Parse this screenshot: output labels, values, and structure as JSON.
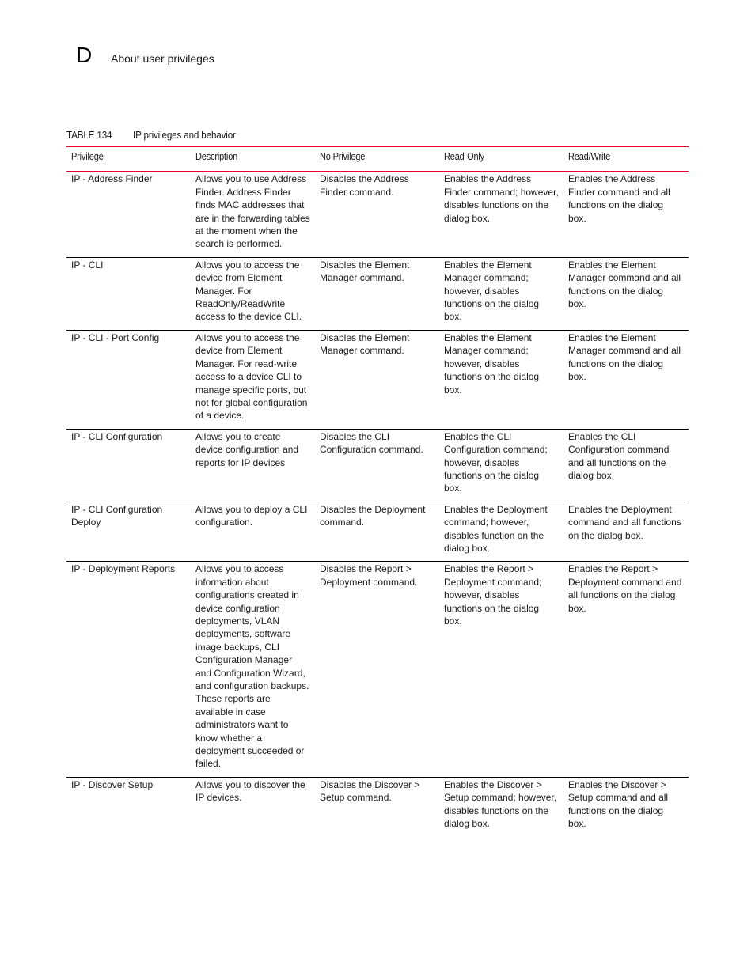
{
  "header": {
    "chapter_letter": "D",
    "section_title": "About user privileges"
  },
  "table": {
    "caption_number": "TABLE 134",
    "caption_title": "IP privileges and behavior",
    "columns": [
      "Privilege",
      "Description",
      "No Privilege",
      "Read-Only",
      "Read/Write"
    ],
    "rows": [
      {
        "privilege": "IP - Address Finder",
        "description": "Allows you to use Address Finder. Address Finder finds MAC addresses that are in the forwarding tables at the moment when the search is performed.",
        "no_privilege": "Disables the Address Finder command.",
        "read_only": "Enables the Address Finder command; however, disables functions on the dialog box.",
        "read_write": "Enables the Address Finder command and all functions on the dialog box."
      },
      {
        "privilege": "IP - CLI",
        "description": "Allows you to access the device from Element Manager. For ReadOnly/ReadWrite access to the device CLI.",
        "no_privilege": "Disables the Element Manager command.",
        "read_only": "Enables the Element Manager command; however, disables functions on the dialog box.",
        "read_write": "Enables the Element Manager command and all functions on the dialog box."
      },
      {
        "privilege": "IP - CLI - Port Config",
        "description": "Allows you to access the device from Element Manager. For read-write access to a device CLI to manage specific ports, but not for global configuration of a device.",
        "no_privilege": "Disables the Element Manager command.",
        "read_only": "Enables the Element Manager command; however, disables functions on the dialog box.",
        "read_write": "Enables the Element Manager command and all functions on the dialog box."
      },
      {
        "privilege": "IP - CLI Configuration",
        "description": "Allows you to create device configuration and reports for IP devices",
        "no_privilege": "Disables the CLI Configuration command.",
        "read_only": "Enables the CLI Configuration command; however, disables functions on the dialog box.",
        "read_write": "Enables the CLI Configuration command and all functions on the dialog box."
      },
      {
        "privilege": "IP - CLI Configuration Deploy",
        "description": "Allows you to deploy a CLI configuration.",
        "no_privilege": "Disables the Deployment command.",
        "read_only": "Enables the Deployment command; however, disables function on the dialog box.",
        "read_write": "Enables the Deployment command and all functions on the dialog box."
      },
      {
        "privilege": "IP - Deployment Reports",
        "description": "Allows you to access information about configurations created in device configuration deployments, VLAN deployments, software image backups, CLI Configuration Manager and Configuration Wizard, and configuration backups. These reports are available in case administrators want to know whether a deployment succeeded or failed.",
        "no_privilege": "Disables the Report > Deployment command.",
        "read_only": "Enables the Report > Deployment command; however, disables functions on the dialog box.",
        "read_write": "Enables the Report > Deployment command and all functions on the dialog box."
      },
      {
        "privilege": "IP - Discover Setup",
        "description": "Allows you to discover the IP devices.",
        "no_privilege": "Disables the Discover > Setup command.",
        "read_only": "Enables the Discover > Setup command; however, disables functions on the dialog box.",
        "read_write": "Enables the Discover > Setup command and all functions on the dialog box."
      }
    ]
  },
  "colors": {
    "accent_rule": "#e4002b",
    "row_rule": "#000000",
    "text": "#1a1a1a"
  }
}
